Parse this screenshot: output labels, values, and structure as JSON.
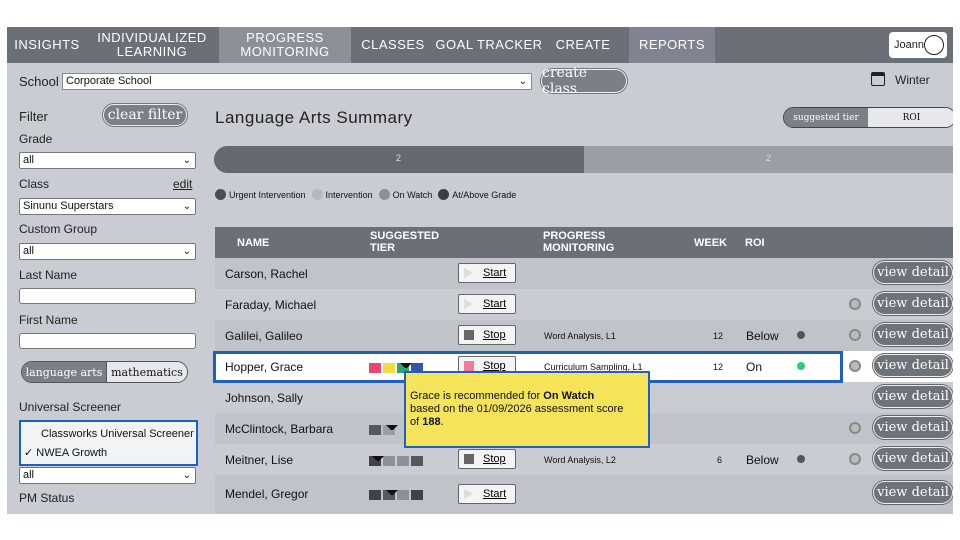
{
  "nav": {
    "items": [
      {
        "label": "INSIGHTS"
      },
      {
        "label": "INDIVIDUALIZED LEARNING"
      },
      {
        "label": "PROGRESS MONITORING"
      },
      {
        "label": "CLASSES"
      },
      {
        "label": "GOAL TRACKER"
      },
      {
        "label": "CREATE"
      },
      {
        "label": "REPORTS"
      }
    ],
    "user": "Joann"
  },
  "schoolbar": {
    "label": "School",
    "school": "Corporate School",
    "create_class": "create class",
    "term": "Winter"
  },
  "sidebar": {
    "filter_label": "Filter",
    "clear_filter": "clear filter",
    "grade_label": "Grade",
    "grade_value": "all",
    "class_label": "Class",
    "class_edit": "edit",
    "class_value": "Sinunu Superstars",
    "custom_group_label": "Custom Group",
    "custom_group_value": "all",
    "last_name_label": "Last Name",
    "first_name_label": "First Name",
    "subject_options": [
      "language arts",
      "mathematics"
    ],
    "universal_screener_label": "Universal Screener",
    "screener_options": [
      "Classworks Universal Screener",
      "✓ NWEA Growth"
    ],
    "screener_value": "all",
    "pm_status_label": "PM Status"
  },
  "main": {
    "title": "Language Arts Summary",
    "toggle": [
      "suggested tier",
      "ROI"
    ],
    "progress": {
      "left_count": "2",
      "right_count": "2",
      "fraction": 0.5
    },
    "legend": [
      {
        "label": "Urgent Intervention",
        "color": "#4a4d53"
      },
      {
        "label": "Intervention",
        "color": "#b5b8be"
      },
      {
        "label": "On Watch",
        "color": "#8d9097"
      },
      {
        "label": "At/Above Grade",
        "color": "#3a3d42"
      }
    ],
    "columns": {
      "name": "NAME",
      "tier": "SUGGESTED TIER",
      "pm": "PROGRESS MONITORING",
      "week": "WEEK",
      "roi": "ROI"
    },
    "view_detail": "view detail",
    "rows": [
      {
        "name": "Carson, Rachel",
        "action": "Start",
        "pm": "",
        "week": "",
        "roi": ""
      },
      {
        "name": "Faraday, Michael",
        "action": "Start",
        "pm": "",
        "week": "",
        "roi": ""
      },
      {
        "name": "Galilei, Galileo",
        "action": "Stop",
        "pm": "Word Analysis, L1",
        "week": "12",
        "roi": "Below"
      },
      {
        "name": "Hopper, Grace",
        "action": "Stop",
        "pm": "Curriculum Sampling, L1",
        "week": "12",
        "roi": "On"
      },
      {
        "name": "Johnson, Sally",
        "action": "",
        "pm": "",
        "week": "",
        "roi": ""
      },
      {
        "name": "McClintock, Barbara",
        "action": "",
        "pm": "",
        "week": "",
        "roi": ""
      },
      {
        "name": "Meitner, Lise",
        "action": "Stop",
        "pm": "Word Analysis, L2",
        "week": "6",
        "roi": "Below"
      },
      {
        "name": "Mendel, Gregor",
        "action": "Start",
        "pm": "",
        "week": "",
        "roi": ""
      }
    ]
  },
  "tooltip": {
    "line1_pre": "Grace is recommended for ",
    "line1_bold": "On Watch",
    "line2": "based on the 01/09/2026 assessment score",
    "line3_pre": "of ",
    "score": "188",
    "line3_post": "."
  },
  "colors": {
    "highlight": "#1f5fbf",
    "tooltip": "#f5e35a",
    "roi_on": "#2ecc71"
  }
}
